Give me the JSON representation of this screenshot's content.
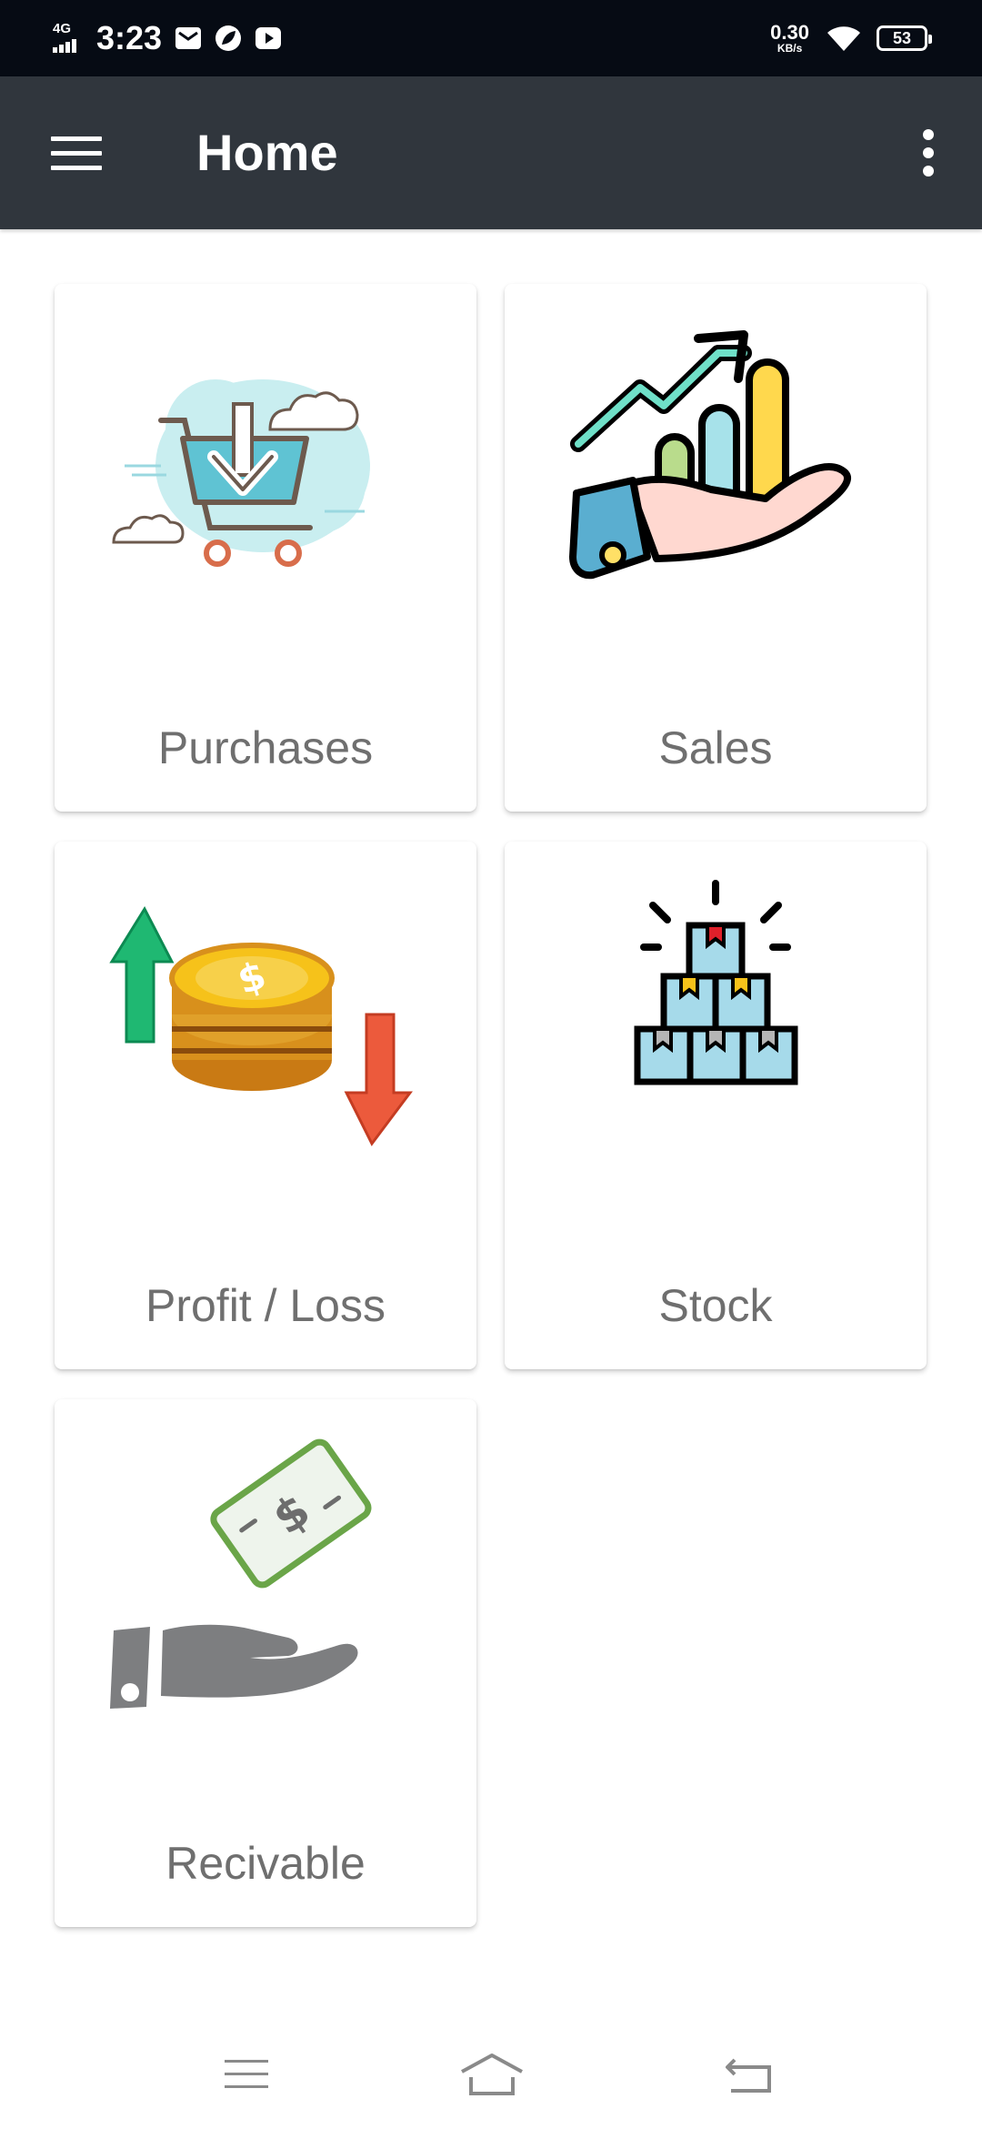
{
  "status_bar": {
    "network_type": "4G",
    "time": "3:23",
    "notification_icons": [
      "mail-icon",
      "leaf-app-icon",
      "youtube-icon"
    ],
    "net_speed": "0.30",
    "net_speed_unit": "KB/s",
    "wifi_icon": "wifi-icon",
    "battery_level": "53"
  },
  "app_bar": {
    "title": "Home",
    "menu_icon": "hamburger-menu-icon",
    "overflow_icon": "more-vertical-icon",
    "background": "#30363d"
  },
  "cards": [
    {
      "label": "Purchases",
      "icon": "shopping-cart-download-icon"
    },
    {
      "label": "Sales",
      "icon": "hand-growth-chart-icon"
    },
    {
      "label": "Profit / Loss",
      "icon": "coins-up-down-arrows-icon"
    },
    {
      "label": "Stock",
      "icon": "stacked-boxes-icon"
    },
    {
      "label": "Recivable",
      "icon": "hand-receiving-money-icon"
    }
  ],
  "nav_bar": {
    "recents_icon": "recents-menu-icon",
    "home_icon": "home-icon",
    "back_icon": "back-icon"
  }
}
